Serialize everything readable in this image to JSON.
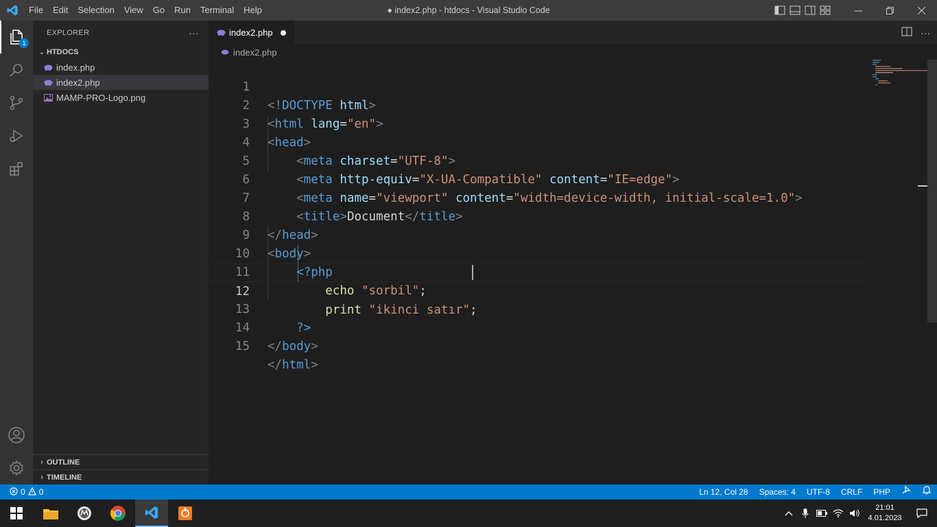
{
  "window": {
    "title": "● index2.php - htdocs - Visual Studio Code",
    "menu": [
      "File",
      "Edit",
      "Selection",
      "View",
      "Go",
      "Run",
      "Terminal",
      "Help"
    ]
  },
  "activity_bar": {
    "items": [
      "explorer-icon",
      "search-icon",
      "source-control-icon",
      "run-debug-icon",
      "extensions-icon"
    ],
    "explorer_badge": "1",
    "bottom_items": [
      "accounts-icon",
      "manage-gear-icon"
    ]
  },
  "sidebar": {
    "title": "EXPLORER",
    "more": "···",
    "folder": "HTDOCS",
    "files": [
      {
        "name": "index.php",
        "icon": "php-elephant-icon",
        "selected": false
      },
      {
        "name": "index2.php",
        "icon": "php-elephant-icon",
        "selected": true
      },
      {
        "name": "MAMP-PRO-Logo.png",
        "icon": "image-file-icon",
        "selected": false
      }
    ],
    "outline": "OUTLINE",
    "timeline": "TIMELINE"
  },
  "editor": {
    "tab_label": "index2.php",
    "tab_dirty": true,
    "breadcrumb": "index2.php",
    "current_line": 12,
    "lines": [
      {
        "n": "1"
      },
      {
        "n": "2"
      },
      {
        "n": "3"
      },
      {
        "n": "4"
      },
      {
        "n": "5"
      },
      {
        "n": "6"
      },
      {
        "n": "7"
      },
      {
        "n": "8"
      },
      {
        "n": "9"
      },
      {
        "n": "10"
      },
      {
        "n": "11"
      },
      {
        "n": "12"
      },
      {
        "n": "13"
      },
      {
        "n": "14"
      },
      {
        "n": "15"
      }
    ],
    "code": {
      "l1": [
        "<!",
        "DOCTYPE",
        " html",
        ">"
      ],
      "l2": [
        "<",
        "html",
        " lang",
        "=",
        "\"en\"",
        ">"
      ],
      "l3": [
        "<",
        "head",
        ">"
      ],
      "l4": [
        "<",
        "meta",
        " charset",
        "=",
        "\"UTF-8\"",
        ">"
      ],
      "l5": [
        "<",
        "meta",
        " http-equiv",
        "=",
        "\"X-UA-Compatible\"",
        " content",
        "=",
        "\"IE=edge\"",
        ">"
      ],
      "l6": [
        "<",
        "meta",
        " name",
        "=",
        "\"viewport\"",
        " content",
        "=",
        "\"width=device-width, initial-scale=1.0\"",
        ">"
      ],
      "l7": [
        "<",
        "title",
        ">",
        "Document",
        "</",
        "title",
        ">"
      ],
      "l8": [
        "</",
        "head",
        ">"
      ],
      "l9": [
        "<",
        "body",
        ">"
      ],
      "l10": [
        "<?php"
      ],
      "l11": [
        "echo",
        " ",
        "\"sorbil\"",
        ";"
      ],
      "l12": [
        "print",
        " ",
        "\"ikinci satır\"",
        ";"
      ],
      "l13": [
        "?>"
      ],
      "l14": [
        "</",
        "body",
        ">"
      ],
      "l15": [
        "</",
        "html",
        ">"
      ]
    }
  },
  "statusbar": {
    "errors": "0",
    "warnings": "0",
    "position": "Ln 12, Col 28",
    "spaces": "Spaces: 4",
    "encoding": "UTF-8",
    "eol": "CRLF",
    "language": "PHP"
  },
  "taskbar": {
    "apps": [
      "windows-start-icon",
      "file-explorer-icon",
      "app-icon",
      "chrome-icon",
      "vscode-icon",
      "app-icon"
    ],
    "time": "21:01",
    "date": "4.01.2023"
  },
  "colors": {
    "accent": "#007acc",
    "tag": "#569cd6",
    "attribute": "#9cdcfe",
    "string": "#ce9178",
    "punctuation": "#808080"
  }
}
